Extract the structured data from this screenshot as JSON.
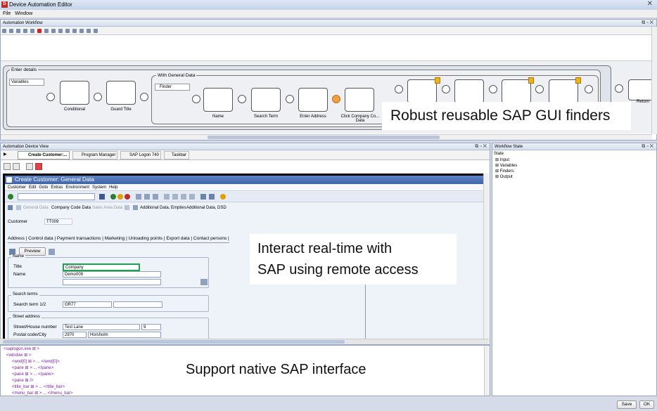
{
  "window": {
    "title": "Device Automation Editor",
    "close": "✕"
  },
  "menu": [
    "File",
    "Window"
  ],
  "workflow": {
    "panel_title": "Automation Workflow",
    "group_enter": "Enter details",
    "variables": "Variables",
    "group_general": "With General Data",
    "finder": "Finder",
    "nodes": [
      "Conditional",
      "Guard Title",
      "Name",
      "Search Term",
      "Enter Address",
      "Click Company Co... Data",
      "Return"
    ]
  },
  "callouts": {
    "finders": "Robust reusable SAP GUI finders",
    "interact_line1": "Interact real-time with",
    "interact_line2": "SAP using remote access",
    "native": "Support native SAP interface"
  },
  "device_view": {
    "panel_title": "Automation Device View",
    "tabs": [
      "Create Customer:...",
      "Program Manager",
      "SAP Logon 740",
      "Taskbar"
    ]
  },
  "sap": {
    "title": "Create Customer: General Data",
    "menu": [
      "Customer",
      "Edit",
      "Goto",
      "Extras",
      "Environment",
      "System",
      "Help"
    ],
    "appbar": [
      "General Data",
      "Company Code Data",
      "Sales Area Data",
      "Additional Data, Empties",
      "Additional Data, DSD"
    ],
    "customer_label": "Customer",
    "customer_value": "TT009",
    "tabs": [
      "Address",
      "Control data",
      "Payment transactions",
      "Marketing",
      "Unloading points",
      "Export data",
      "Contact persons"
    ],
    "preview": "Preview",
    "name_frame": "Name",
    "title_label": "Title",
    "title_value": "Company",
    "name_label": "Name",
    "name_value": "Demo009",
    "search_frame": "Search terms",
    "search_label": "Search term 1/2",
    "search_value": "GR77",
    "street_frame": "Street address",
    "street_label": "Street/House number",
    "street_value": "Test Lane",
    "house_value": "9",
    "postal_label": "Postal code/City",
    "postal_value": "2970",
    "city_value": "Horsholm"
  },
  "xml_tree": [
    "<saplogon.exe ⊞ >",
    "<window ⊞ >",
    "<wnd[0] ⊞ > ... </wnd[0]>",
    "<pane ⊞ > ... </pane>",
    "<pane ⊞ > ... </pane>",
    "<pane ⊞ />",
    "<title_bar ⊞ > ... </title_bar>",
    "<menu_bar ⊞ > ... </menu_bar>"
  ],
  "workflow_state": {
    "panel_title": "Workflow State",
    "root": "State",
    "items": [
      "Input",
      "Variables",
      "Finders",
      "Output"
    ]
  },
  "buttons": {
    "save": "Save",
    "ok": "OK"
  },
  "colors": {
    "highlight": "#1aa34a",
    "warning": "#f2b01e",
    "sap_title": "#4a6fb3"
  }
}
